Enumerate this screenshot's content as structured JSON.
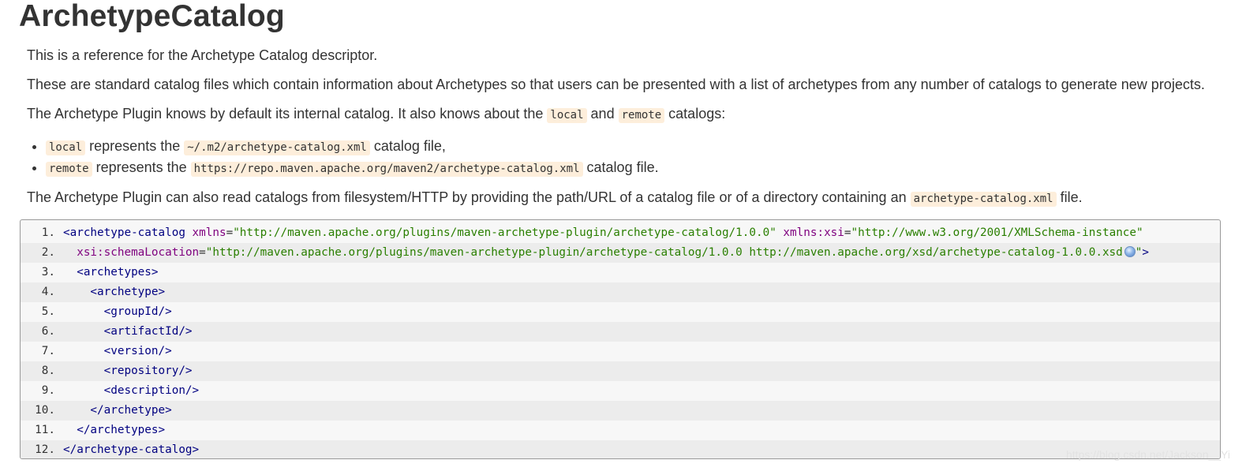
{
  "page": {
    "title": "ArchetypeCatalog"
  },
  "intro": {
    "p1": "This is a reference for the Archetype Catalog descriptor.",
    "p2": "These are standard catalog files which contain information about Archetypes so that users can be presented with a list of archetypes from any number of catalogs to generate new projects.",
    "p3_a": "The Archetype Plugin knows by default its internal catalog. It also knows about the ",
    "p3_code1": "local",
    "p3_b": " and ",
    "p3_code2": "remote",
    "p3_c": " catalogs:"
  },
  "bullets": [
    {
      "code": "local",
      "text_a": " represents the ",
      "path": "~/.m2/archetype-catalog.xml",
      "text_b": " catalog file,"
    },
    {
      "code": "remote",
      "text_a": " represents the ",
      "path": "https://repo.maven.apache.org/maven2/archetype-catalog.xml",
      "text_b": " catalog file."
    }
  ],
  "p4": {
    "text_a": "The Archetype Plugin can also read catalogs from filesystem/HTTP by providing the path/URL of a catalog file or of a directory containing an ",
    "code": "archetype-catalog.xml",
    "text_b": " file."
  },
  "code_block": {
    "line_numbers": [
      "1.",
      "2.",
      "3.",
      "4.",
      "5.",
      "6.",
      "7.",
      "8.",
      "9.",
      "10.",
      "11.",
      "12."
    ],
    "l1_tag": "<archetype-catalog",
    "l1_attr1": "xmlns",
    "l1_val1": "\"http://maven.apache.org/plugins/maven-archetype-plugin/archetype-catalog/1.0.0\"",
    "l1_attr2": "xmlns:xsi",
    "l1_val2": "\"http://www.w3.org/2001/XMLSchema-instance\"",
    "l2_indent": "  ",
    "l2_attr": "xsi:schemaLocation",
    "l2_val": "\"http://maven.apache.org/plugins/maven-archetype-plugin/archetype-catalog/1.0.0 http://maven.apache.org/xsd/archetype-catalog-1.0.0.xsd",
    "l2_end_quote": "\"",
    "l2_close": ">",
    "lines_rest": [
      "  <archetypes>",
      "    <archetype>",
      "      <groupId/>",
      "      <artifactId/>",
      "      <version/>",
      "      <repository/>",
      "      <description/>",
      "    </archetype>",
      "  </archetypes>",
      "</archetype-catalog>"
    ],
    "external_link_icon": "globe-icon"
  },
  "watermark": "https://blog.csdn.net/Jackson__Yi"
}
